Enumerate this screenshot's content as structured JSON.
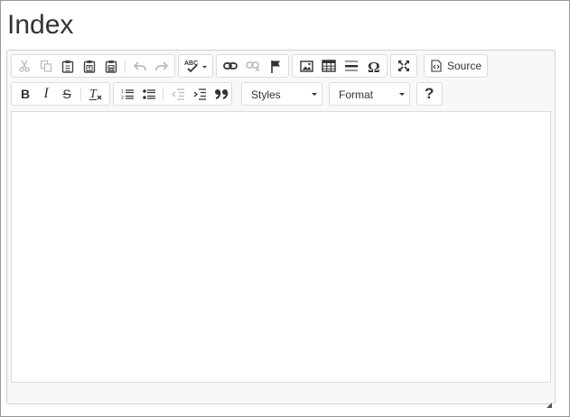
{
  "page": {
    "title": "Index"
  },
  "toolbar": {
    "clipboard": [
      {
        "name": "cut-icon",
        "label": "Cut",
        "enabled": false
      },
      {
        "name": "copy-icon",
        "label": "Copy",
        "enabled": false
      },
      {
        "name": "paste-icon",
        "label": "Paste",
        "enabled": true
      },
      {
        "name": "paste-text-icon",
        "label": "Paste as plain text",
        "enabled": true
      },
      {
        "name": "paste-word-icon",
        "label": "Paste from Word",
        "enabled": true
      },
      {
        "name": "undo-icon",
        "label": "Undo",
        "enabled": false
      },
      {
        "name": "redo-icon",
        "label": "Redo",
        "enabled": false
      }
    ],
    "spellcheck": {
      "name": "spellcheck-icon",
      "label": "ABC"
    },
    "links": [
      "link-icon",
      "unlink-icon",
      "anchor-icon"
    ],
    "insert": [
      "image-icon",
      "table-icon",
      "horizontal-rule-icon",
      "special-char-icon"
    ],
    "maximize": "maximize-icon",
    "source_label": "Source",
    "basic": [
      "bold-icon",
      "italic-icon",
      "strike-icon",
      "remove-format-icon"
    ],
    "paragraph": [
      "numbered-list-icon",
      "bulleted-list-icon",
      "outdent-icon",
      "indent-icon",
      "blockquote-icon"
    ],
    "styles_label": "Styles",
    "format_label": "Format",
    "help_label": "?"
  },
  "editor": {
    "content": ""
  }
}
